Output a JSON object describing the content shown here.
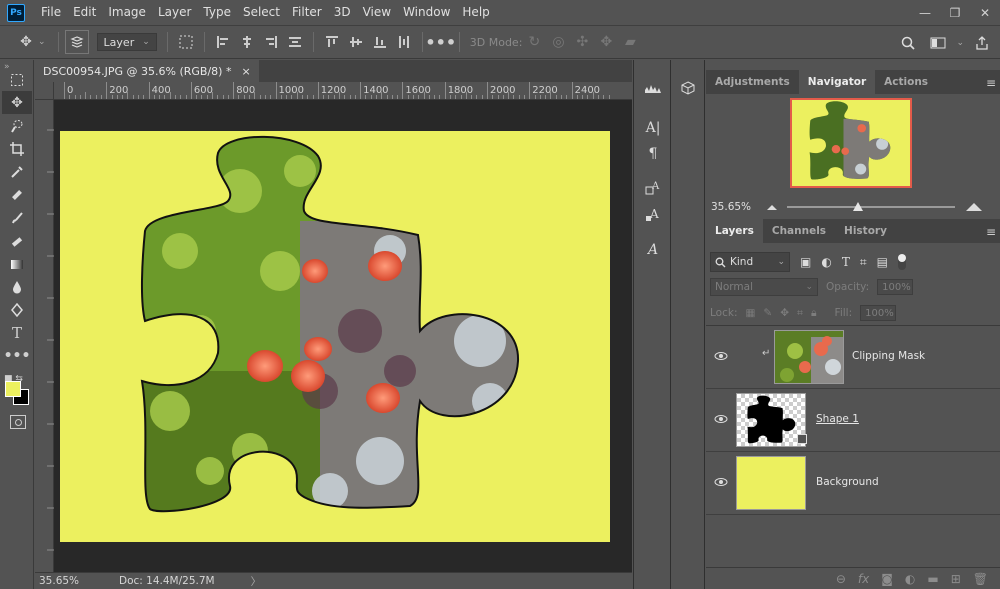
{
  "app": {
    "logo": "Ps"
  },
  "menu": [
    "File",
    "Edit",
    "Image",
    "Layer",
    "Type",
    "Select",
    "Filter",
    "3D",
    "View",
    "Window",
    "Help"
  ],
  "window_controls": {
    "minimize": "—",
    "restore": "❐",
    "close": "✕"
  },
  "options_bar": {
    "auto_select_target": "Layer",
    "mode_label": "3D Mode:"
  },
  "document": {
    "tab_title": "DSC00954.JPG @ 35.6% (RGB/8) *",
    "tab_close": "×",
    "ruler_ticks": [
      "0",
      "200",
      "400",
      "600",
      "800",
      "1000",
      "1200",
      "1400",
      "1600",
      "1800",
      "2000",
      "2200",
      "2400"
    ],
    "canvas_color": "#ecf05f",
    "status_zoom": "35.65%",
    "status_doc": "Doc: 14.4M/25.7M",
    "status_arrow": "〉"
  },
  "colors": {
    "foreground": "#ecf05f",
    "background": "#000000",
    "accent_red": "#e35b4a"
  },
  "navigator_panel": {
    "tabs": [
      "Adjustments",
      "Navigator",
      "Actions"
    ],
    "active_tab": "Navigator",
    "zoom": "35.65%"
  },
  "layers_panel": {
    "tabs": [
      "Layers",
      "Channels",
      "History"
    ],
    "active_tab": "Layers",
    "filter_kind": "Kind",
    "blend_mode": "Normal",
    "opacity_label": "Opacity:",
    "opacity_value": "100%",
    "lock_label": "Lock:",
    "fill_label": "Fill:",
    "fill_value": "100%",
    "layers": [
      {
        "name": "Clipping Mask",
        "type": "photo",
        "clipped": true
      },
      {
        "name": "Shape 1",
        "type": "shape",
        "underline": true
      },
      {
        "name": "Background",
        "type": "fill"
      }
    ]
  },
  "icons": {
    "move": "move-icon",
    "eye": "eye-icon",
    "search": "search-icon",
    "share": "share-icon",
    "link": "link-icon",
    "fx": "fx-icon",
    "mask": "mask-icon",
    "adjustment": "adjustment-icon",
    "folder": "folder-icon",
    "new_layer": "new-layer-icon",
    "trash": "trash-icon"
  }
}
